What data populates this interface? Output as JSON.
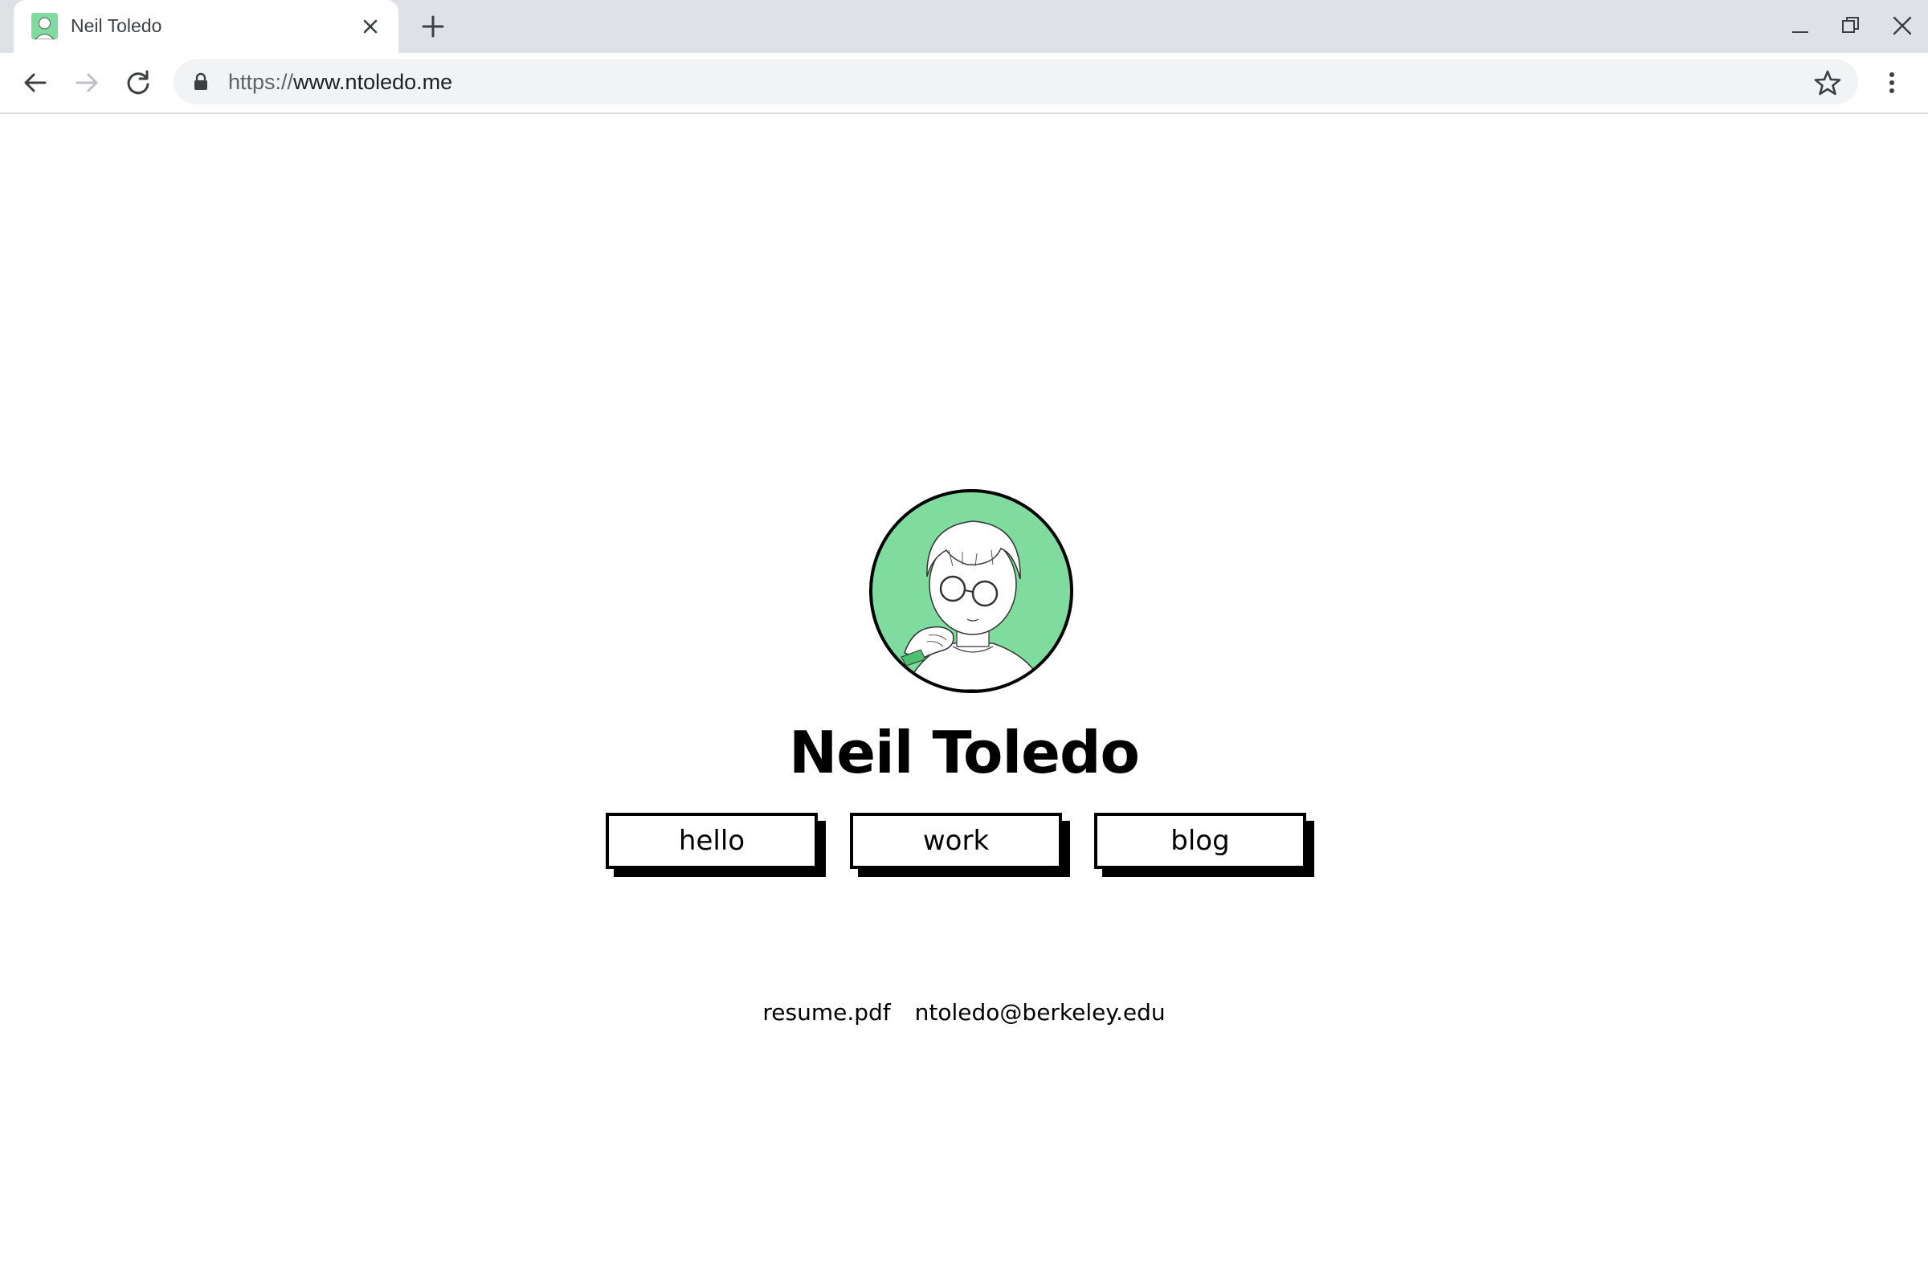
{
  "browser": {
    "tab": {
      "title": "Neil Toledo"
    },
    "address_bar": {
      "scheme": "https://",
      "host": "www.ntoledo.me"
    },
    "icons": {
      "favicon": "portrait-favicon",
      "tab_close": "close-icon",
      "new_tab": "plus-icon",
      "minimize": "minimize-icon",
      "restore": "restore-icon",
      "close_window": "close-icon",
      "back": "back-arrow-icon",
      "forward": "forward-arrow-icon",
      "reload": "reload-icon",
      "lock": "lock-icon",
      "bookmark": "star-icon",
      "menu": "kebab-menu-icon"
    }
  },
  "page": {
    "name": "Neil Toledo",
    "nav": [
      {
        "label": "hello"
      },
      {
        "label": "work"
      },
      {
        "label": "blog"
      }
    ],
    "links": {
      "resume": "resume.pdf",
      "email": "ntoledo@berkeley.edu"
    },
    "colors": {
      "avatar_bg": "#7fdc9e",
      "text": "#000000"
    }
  }
}
